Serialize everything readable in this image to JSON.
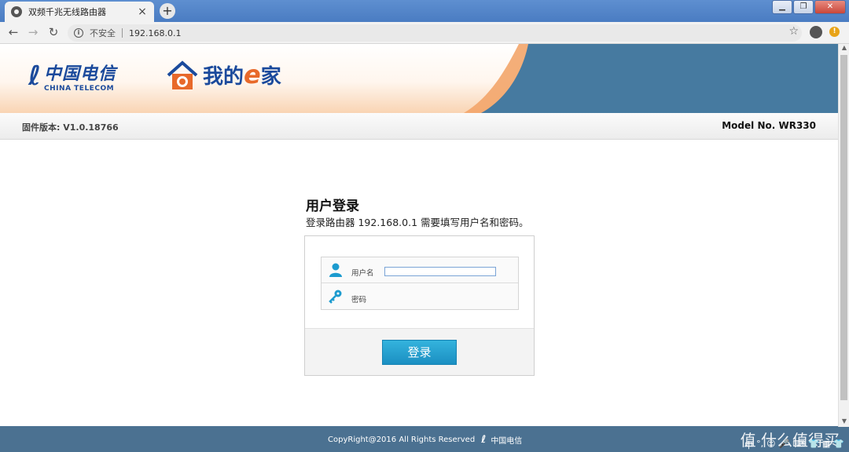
{
  "browser": {
    "tab_title": "双频千兆无线路由器",
    "tab_close": "×",
    "new_tab": "+",
    "security_label": "不安全",
    "url": "192.168.0.1",
    "window_buttons": [
      "▁",
      "❐",
      "✕"
    ]
  },
  "banner": {
    "brand_cn": "中国电信",
    "brand_en": "CHINA TELECOM",
    "slogan_pre": "我的",
    "slogan_e": "e",
    "slogan_post": "家"
  },
  "infobar": {
    "firmware": "固件版本: V1.0.18766",
    "model": "Model No. WR330"
  },
  "login": {
    "title": "用户登录",
    "description": "登录路由器 192.168.0.1 需要填写用户名和密码。",
    "username_label": "用户名",
    "username_value": "",
    "password_label": "密码",
    "submit_label": "登录"
  },
  "footer": {
    "copyright": "CopyRight@2016 All Rights Reserved",
    "brand": "中国电信",
    "watermark": "值 什么值得买",
    "tray": [
      "中",
      "°,",
      "☺",
      "🎤",
      "⌨",
      "👕",
      "▦",
      "👕"
    ]
  },
  "colors": {
    "accent": "#1b8fc2",
    "banner_blue": "#467aa0",
    "footer": "#4b7191",
    "telecom_blue": "#1b4a9c"
  }
}
